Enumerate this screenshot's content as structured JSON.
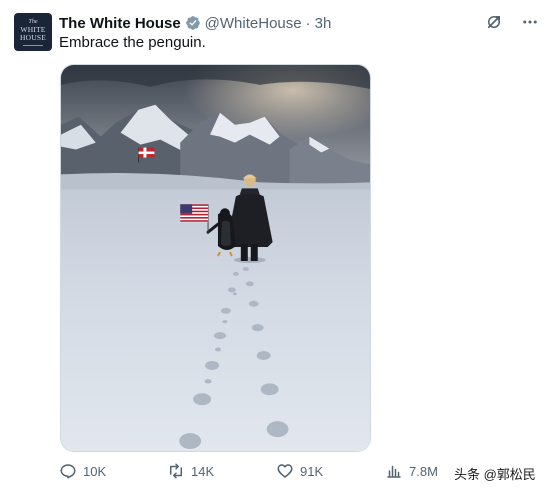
{
  "post": {
    "author_name": "The White House",
    "handle": "@WhiteHouse",
    "separator": "·",
    "time": "3h",
    "text": "Embrace the penguin."
  },
  "avatar": {
    "line1": "The",
    "line2": "WHITE",
    "line3": "HOUSE"
  },
  "stats": {
    "replies": "10K",
    "reposts": "14K",
    "likes": "91K",
    "views": "7.8M"
  },
  "watermark": "头条 @郭松民",
  "icons": {
    "verified": "verified-badge-icon",
    "grok": "grok-icon",
    "more": "more-icon",
    "reply": "reply-icon",
    "repost": "repost-icon",
    "like": "like-icon",
    "views": "views-icon",
    "bookmark": "bookmark-icon",
    "share": "share-icon"
  },
  "colors": {
    "verified": "#829aab",
    "muted": "#536471",
    "text": "#0f1419"
  }
}
